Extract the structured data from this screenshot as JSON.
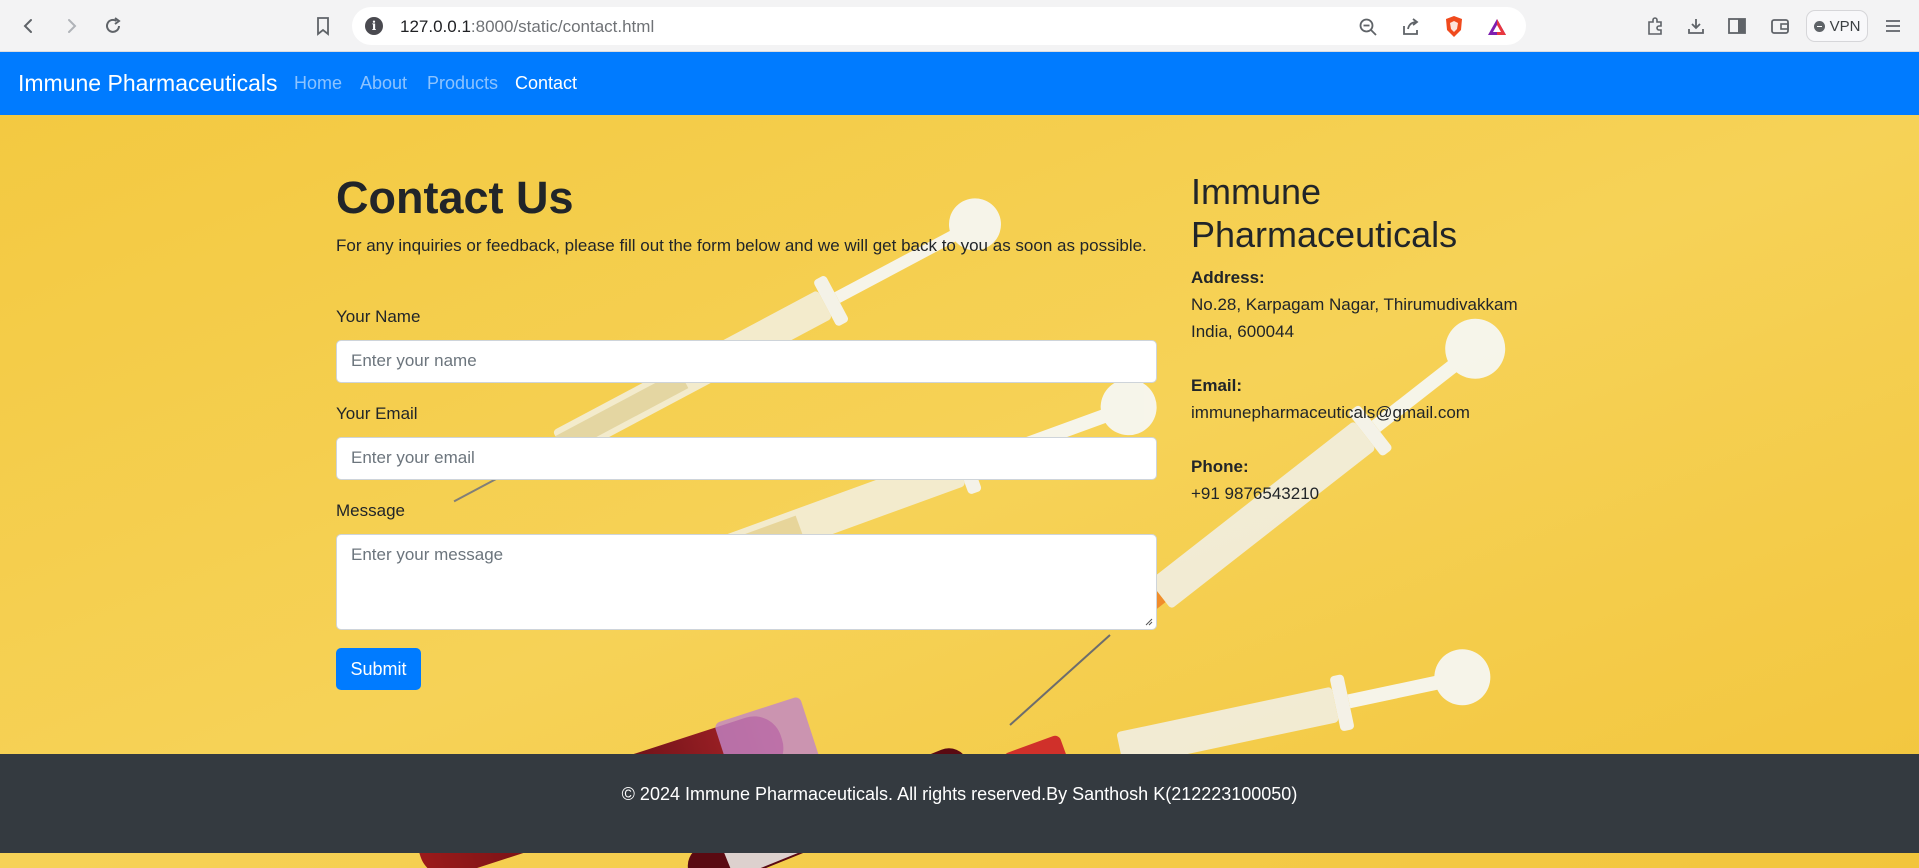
{
  "browser": {
    "url_host": "127.0.0.1",
    "url_path": ":8000/static/contact.html",
    "vpn_label": "VPN",
    "icons": [
      "back-icon",
      "forward-icon",
      "reload-icon",
      "bookmark-icon",
      "info-icon",
      "zoom-out-icon",
      "share-icon",
      "brave-shield-icon",
      "brave-rewards-icon",
      "extensions-icon",
      "download-icon",
      "sidebar-icon",
      "wallet-icon",
      "menu-icon"
    ]
  },
  "navbar": {
    "brand": "Immune Pharmaceuticals",
    "links": [
      {
        "label": "Home",
        "active": false
      },
      {
        "label": "About",
        "active": false
      },
      {
        "label": "Products",
        "active": false
      },
      {
        "label": "Contact",
        "active": true
      }
    ]
  },
  "contact": {
    "title": "Contact Us",
    "intro": "For any inquiries or feedback, please fill out the form below and we will get back to you as soon as possible.",
    "name_label": "Your Name",
    "name_placeholder": "Enter your name",
    "email_label": "Your Email",
    "email_placeholder": "Enter your email",
    "message_label": "Message",
    "message_placeholder": "Enter your message",
    "submit_label": "Submit"
  },
  "company": {
    "name": "Immune Pharmaceuticals",
    "address_label": "Address:",
    "address_line1": "No.28, Karpagam Nagar, Thirumudivakkam",
    "address_line2": "India, 600044",
    "email_label": "Email:",
    "email": "immunepharmaceuticals@gmail.com",
    "phone_label": "Phone:",
    "phone": "+91 9876543210"
  },
  "footer": {
    "text": "© 2024 Immune Pharmaceuticals. All rights reserved.By Santhosh K(212223100050)"
  },
  "colors": {
    "primary": "#007bff",
    "background": "#f4cd47",
    "footer": "#343a40"
  }
}
